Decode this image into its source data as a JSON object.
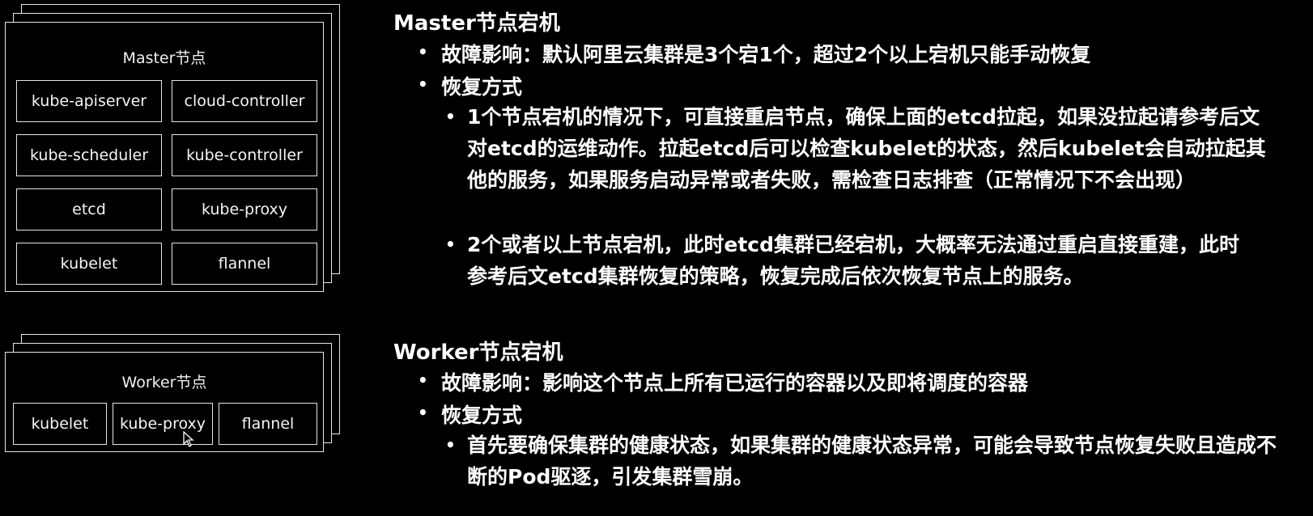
{
  "master_diagram": {
    "title": "Master节点",
    "components": [
      "kube-apiserver",
      "cloud-controller",
      "kube-scheduler",
      "kube-controller",
      "etcd",
      "kube-proxy",
      "kubelet",
      "flannel"
    ]
  },
  "worker_diagram": {
    "title": "Worker节点",
    "components": [
      "kubelet",
      "kube-proxy",
      "flannel"
    ]
  },
  "master_section": {
    "heading": "Master节点宕机",
    "impact": "故障影响：默认阿里云集群是3个宕1个，超过2个以上宕机只能手动恢复",
    "recovery_label": "恢复方式",
    "sub1": "1个节点宕机的情况下，可直接重启节点，确保上面的etcd拉起，如果没拉起请参考后文对etcd的运维动作。拉起etcd后可以检查kubelet的状态，然后kubelet会自动拉起其他的服务，如果服务启动异常或者失败，需检查日志排查（正常情况下不会出现）",
    "sub2": "2个或者以上节点宕机，此时etcd集群已经宕机，大概率无法通过重启直接重建，此时参考后文etcd集群恢复的策略，恢复完成后依次恢复节点上的服务。"
  },
  "worker_section": {
    "heading": "Worker节点宕机",
    "impact": "故障影响：影响这个节点上所有已运行的容器以及即将调度的容器",
    "recovery_label": "恢复方式",
    "sub1": "首先要确保集群的健康状态，如果集群的健康状态异常，可能会导致节点恢复失败且造成不断的Pod驱逐，引发集群雪崩。"
  }
}
